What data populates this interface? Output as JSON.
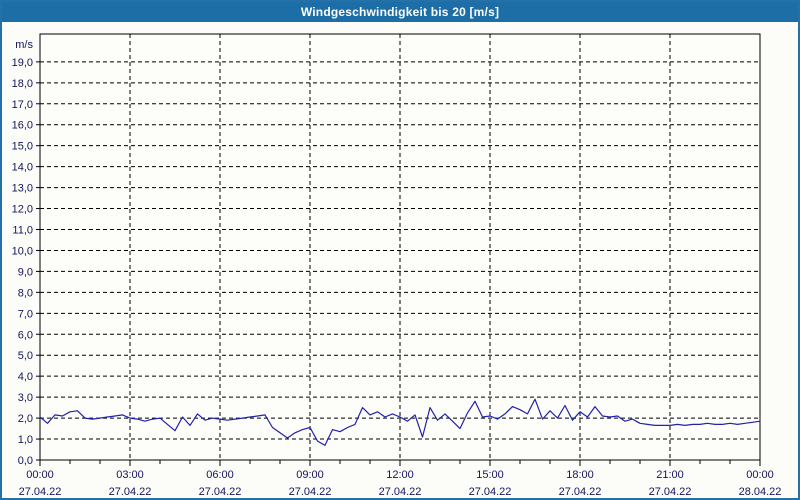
{
  "window": {
    "title": "Windgeschwindigkeit bis 20 [m/s]"
  },
  "colors": {
    "titlebar_bg": "#1d6da6",
    "titlebar_text": "#ffffff",
    "outer_border": "#2470a8",
    "page_bg": "#fcfdf8",
    "plot_bg": "#fdfdfa",
    "grid": "#000000",
    "axis_text": "#14145f",
    "line": "#2222ac"
  },
  "chart_data": {
    "type": "line",
    "title": "Windgeschwindigkeit bis 20 [m/s]",
    "ylabel_unit": "m/s",
    "ylim": [
      0,
      20.33
    ],
    "y_major_step": 1.0,
    "y_tick_labels": [
      "0,0",
      "1,0",
      "2,0",
      "3,0",
      "4,0",
      "5,0",
      "6,0",
      "7,0",
      "8,0",
      "9,0",
      "10,0",
      "11,0",
      "12,0",
      "13,0",
      "14,0",
      "15,0",
      "16,0",
      "17,0",
      "18,0",
      "19,0"
    ],
    "x_hours_range": [
      0,
      24
    ],
    "x_minor_step_hours": 1,
    "x_major_ticks": [
      {
        "hour": 0,
        "time": "00:00",
        "date": "27.04.22"
      },
      {
        "hour": 3,
        "time": "03:00",
        "date": "27.04.22"
      },
      {
        "hour": 6,
        "time": "06:00",
        "date": "27.04.22"
      },
      {
        "hour": 9,
        "time": "09:00",
        "date": "27.04.22"
      },
      {
        "hour": 12,
        "time": "12:00",
        "date": "27.04.22"
      },
      {
        "hour": 15,
        "time": "15:00",
        "date": "27.04.22"
      },
      {
        "hour": 18,
        "time": "18:00",
        "date": "27.04.22"
      },
      {
        "hour": 21,
        "time": "21:00",
        "date": "27.04.22"
      },
      {
        "hour": 24,
        "time": "00:00",
        "date": "28.04.22"
      }
    ],
    "grid": "dashed",
    "legend": "none",
    "series": [
      {
        "name": "Windgeschwindigkeit",
        "unit": "m/s",
        "color": "#2222ac",
        "x_step_hours": 0.25,
        "values": [
          2.05,
          1.75,
          2.15,
          2.1,
          2.3,
          2.35,
          2.0,
          1.95,
          2.0,
          2.05,
          2.1,
          2.15,
          2.0,
          1.95,
          1.85,
          1.95,
          2.0,
          1.7,
          1.4,
          2.05,
          1.65,
          2.2,
          1.9,
          2.0,
          1.95,
          1.9,
          1.95,
          2.0,
          2.05,
          2.1,
          2.15,
          1.55,
          1.3,
          1.05,
          1.3,
          1.45,
          1.55,
          0.9,
          0.7,
          1.45,
          1.35,
          1.55,
          1.7,
          2.5,
          2.15,
          2.3,
          2.05,
          2.2,
          2.05,
          1.85,
          2.15,
          1.1,
          2.5,
          1.9,
          2.2,
          1.85,
          1.5,
          2.25,
          2.8,
          2.05,
          2.1,
          1.95,
          2.2,
          2.55,
          2.4,
          2.2,
          2.9,
          1.95,
          2.35,
          2.0,
          2.6,
          1.9,
          2.3,
          2.05,
          2.55,
          2.1,
          2.05,
          2.1,
          1.85,
          1.95,
          1.75,
          1.7,
          1.65,
          1.65,
          1.65,
          1.7,
          1.65,
          1.7,
          1.7,
          1.75,
          1.7,
          1.7,
          1.75,
          1.7,
          1.75,
          1.8,
          1.85
        ]
      }
    ]
  }
}
